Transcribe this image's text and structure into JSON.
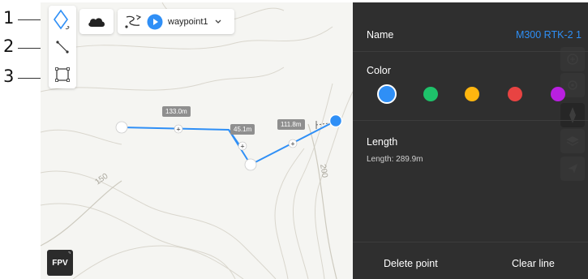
{
  "callouts": [
    "1",
    "2",
    "3"
  ],
  "toolbox": {
    "tools": [
      {
        "name": "waypoint-tool",
        "icon": "diamond-pin-icon",
        "active": true
      },
      {
        "name": "line-tool",
        "icon": "polyline-icon",
        "active": false
      },
      {
        "name": "area-tool",
        "icon": "rectangle-area-icon",
        "active": false
      }
    ]
  },
  "toolbar": {
    "cloud_icon": "cloud-icon",
    "route_icon": "route-icon",
    "play_icon": "play-icon",
    "route_name": "waypoint1",
    "dropdown_icon": "chevron-down-icon"
  },
  "map": {
    "contour_labels": [
      "150",
      "200"
    ],
    "distances": [
      "133.0m",
      "45.1m",
      "111.8m"
    ],
    "route_color": "#2f8ff6"
  },
  "fpv_label": "FPV",
  "panel": {
    "name_label": "Name",
    "name_value": "M300 RTK-2 1",
    "color_label": "Color",
    "colors": [
      {
        "name": "blue",
        "hex": "#2f8ff6",
        "selected": true
      },
      {
        "name": "green",
        "hex": "#1ec26a",
        "selected": false
      },
      {
        "name": "yellow",
        "hex": "#ffb60f",
        "selected": false
      },
      {
        "name": "red",
        "hex": "#e84342",
        "selected": false
      },
      {
        "name": "purple",
        "hex": "#b91fe0",
        "selected": false
      }
    ],
    "length_label": "Length",
    "length_value": "Length: 289.9m",
    "delete_label": "Delete point",
    "clear_label": "Clear line"
  },
  "accent_color": "#2f8ff6"
}
